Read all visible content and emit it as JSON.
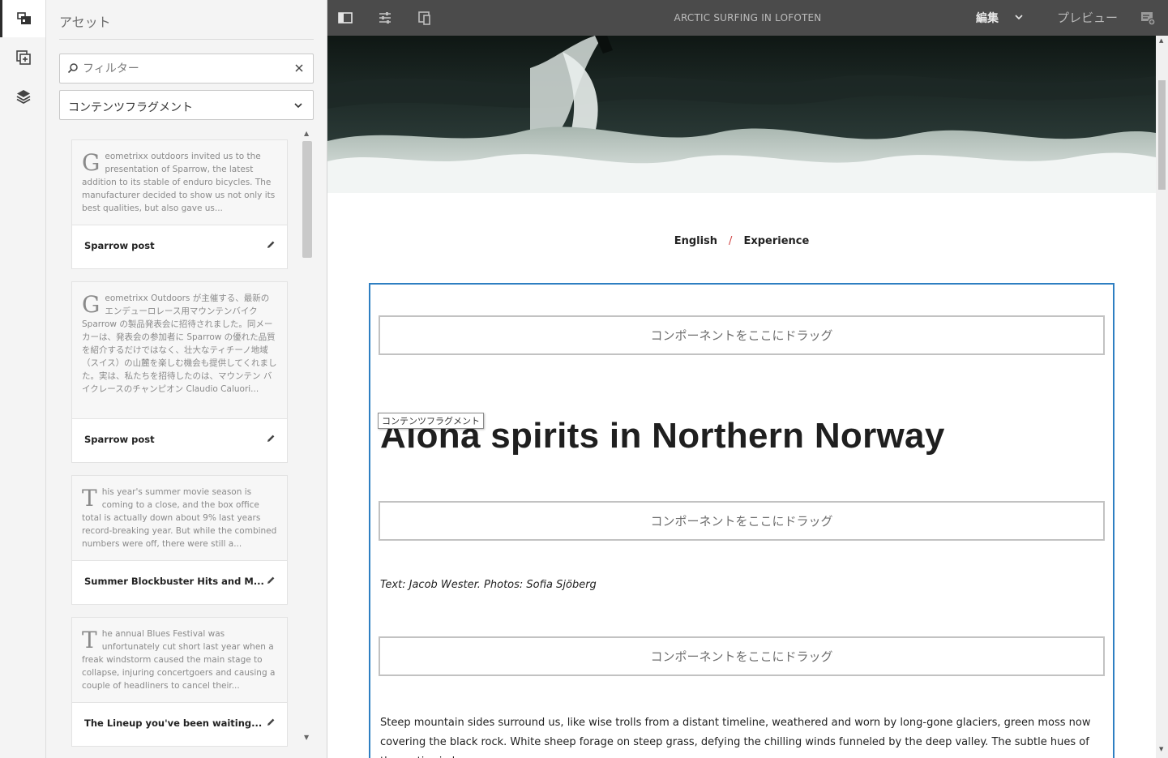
{
  "rail": {
    "items": [
      {
        "icon": "assets-panel-icon",
        "active": true
      },
      {
        "icon": "components-add-icon",
        "active": false
      },
      {
        "icon": "layers-icon",
        "active": false
      }
    ]
  },
  "panel": {
    "title": "アセット",
    "search": {
      "placeholder": "フィルター",
      "value": ""
    },
    "type_select": {
      "value": "コンテンツフラグメント"
    },
    "cards": [
      {
        "dropcap": "G",
        "excerpt": "eometrixx outdoors invited us to the presentation of Sparrow, the latest addition to its stable of enduro bicycles. The manufacturer decided to show us not only its best qualities, but also gave us...",
        "title": "Sparrow post"
      },
      {
        "dropcap": "G",
        "excerpt": "eometrixx Outdoors が主催する、最新のエンデューロレース用マウンテンバイク Sparrow の製品発表会に招待されました。同メーカーは、発表会の参加者に Sparrow の優れた品質を紹介するだけではなく、壮大なティチーノ地域（スイス）の山麓を楽しむ機会も提供してくれました。実は、私たちを招待したのは、マウンテン バイクレースのチャンピオン Claudio Caluori...",
        "title": "Sparrow post"
      },
      {
        "dropcap": "T",
        "excerpt": "his year's summer movie season is coming to a close, and the box office total is actually down about 9% last years record-breaking year. But while the combined numbers were off, there were still a...",
        "title": "Summer Blockbuster Hits and M..."
      },
      {
        "dropcap": "T",
        "excerpt": "he annual Blues Festival was unfortunately cut short last year when a freak windstorm caused the main stage to collapse, injuring concertgoers and causing a couple of headliners to cancel their...",
        "title": "The Lineup you've been waiting..."
      }
    ]
  },
  "toolbar": {
    "page_title": "ARCTIC SURFING IN LOFOTEN",
    "mode_label": "編集",
    "preview_label": "プレビュー"
  },
  "page": {
    "breadcrumb": [
      "English",
      "Experience"
    ],
    "breadcrumb_separator": "/",
    "drop_zone_label": "コンポーネントをここにドラッグ",
    "fragment_tag": "コンテンツフラグメント",
    "headline": "Aloha spirits in Northern Norway",
    "byline": "Text: Jacob Wester. Photos: Sofia Sjöberg",
    "body": "Steep mountain sides surround us, like wise trolls from a distant timeline, weathered and worn by long-gone glaciers, green moss now covering the black rock. White sheep forage on steep grass, defying the chilling winds funneled by the deep valley. The subtle hues of the arctic circle are"
  },
  "colors": {
    "toolbar_bg": "#4b4b4b",
    "selection_border": "#2e7fc2",
    "breadcrumb_separator": "#d04545"
  }
}
